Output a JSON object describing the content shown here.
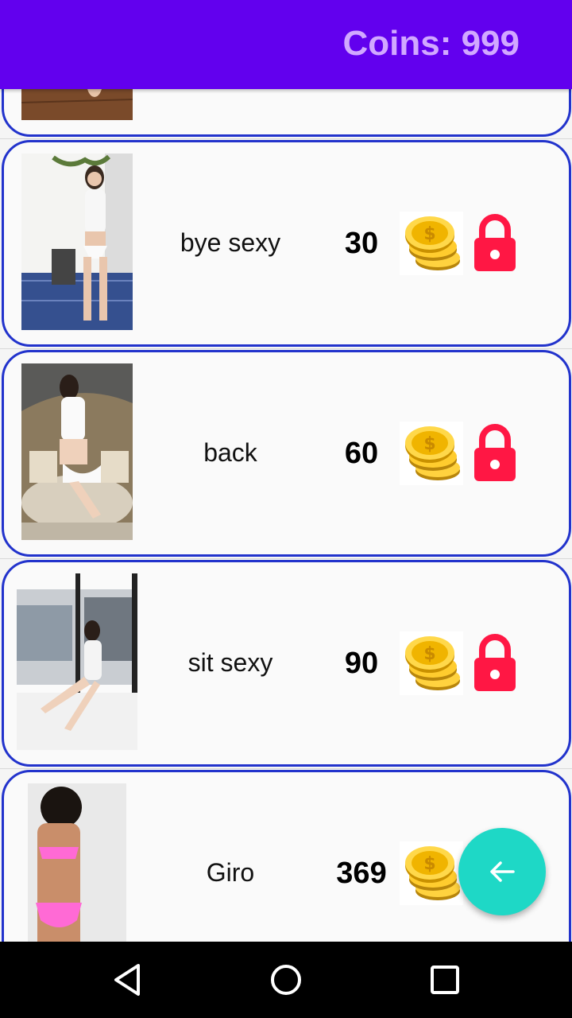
{
  "header": {
    "coins_text": "Coins: 999"
  },
  "items": [
    {
      "title": "",
      "price": ""
    },
    {
      "title": "bye sexy",
      "price": "30"
    },
    {
      "title": "back",
      "price": "60"
    },
    {
      "title": "sit sexy",
      "price": "90"
    },
    {
      "title": "Giro",
      "price": "369"
    }
  ],
  "colors": {
    "app_bar": "#6200ee",
    "coins_text": "#d1a8ff",
    "card_border": "#2233cc",
    "lock": "#ff1744",
    "fab": "#1ed8c6"
  },
  "icons": {
    "coin": "gold-coin-stack-icon",
    "lock": "lock-icon",
    "fab": "arrow-back-icon",
    "nav_back": "triangle-back-icon",
    "nav_home": "circle-home-icon",
    "nav_recents": "square-recents-icon"
  }
}
